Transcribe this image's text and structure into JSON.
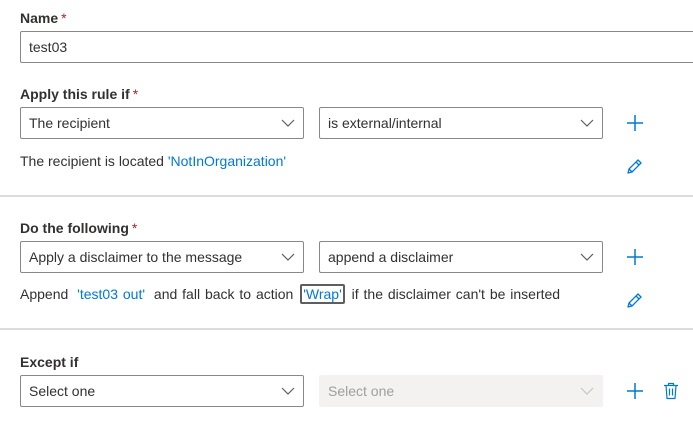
{
  "name_section": {
    "label": "Name",
    "required_marker": "*",
    "value": "test03"
  },
  "apply_rule": {
    "label": "Apply this rule if",
    "required_marker": "*",
    "condition_dropdown": "The recipient",
    "operator_dropdown": "is external/internal",
    "summary_prefix": "The recipient is located",
    "summary_value": "'NotInOrganization'"
  },
  "do_following": {
    "label": "Do the following",
    "required_marker": "*",
    "action_dropdown": "Apply a disclaimer to the message",
    "subaction_dropdown": "append a disclaimer",
    "summary_prefix": "Append",
    "summary_disclaimer": "'test03 out'",
    "summary_middle": "and fall back to action",
    "summary_fallback": "'Wrap'",
    "summary_suffix": "if the disclaimer can't be inserted"
  },
  "except_if": {
    "label": "Except if",
    "condition_dropdown": "Select one",
    "operator_dropdown": "Select one"
  },
  "colors": {
    "accent": "#0078d4",
    "required": "#a4262c",
    "border": "#8a8886",
    "divider": "#dcdcdc",
    "disabled_bg": "#f3f2f1"
  },
  "icons": [
    "chevron-down-icon",
    "add-icon",
    "edit-icon",
    "delete-icon"
  ]
}
